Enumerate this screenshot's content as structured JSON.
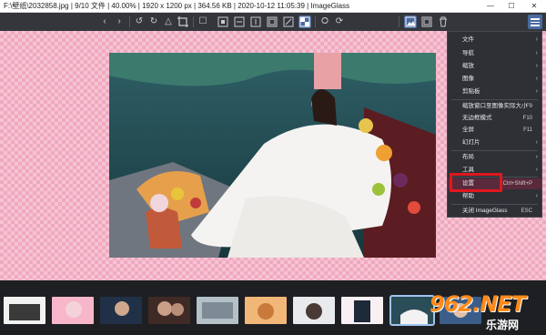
{
  "title_bar": {
    "title": "F:\\壁纸\\2032858.jpg  |  9/10 文件  |  40.00%  |  1920 x 1200 px  |  364.56 KB  |  2020-10-12 11:05:39  |  ImageGlass",
    "minimize_label": "—",
    "maximize_label": "☐",
    "close_label": "✕"
  },
  "toolbar": {
    "icons": [
      "previous-icon",
      "next-icon",
      "rotate-left-icon",
      "rotate-right-icon",
      "flip-icon",
      "crop-icon",
      "zoom-fit-icon",
      "actual-size-icon",
      "fit-width-icon",
      "fit-height-icon",
      "scale-to-fill-icon",
      "lock-zoom-icon",
      "checkerboard-icon",
      "slideshow-icon",
      "thumbnail-icon",
      "fullscreen-icon",
      "delete-icon",
      "menu-icon"
    ]
  },
  "menu": {
    "items": [
      {
        "label": "文件",
        "shortcut": "",
        "submenu": true
      },
      {
        "label": "导航",
        "shortcut": "",
        "submenu": true
      },
      {
        "label": "缩放",
        "shortcut": "",
        "submenu": true
      },
      {
        "label": "图像",
        "shortcut": "",
        "submenu": true
      },
      {
        "label": "剪贴板",
        "shortcut": "",
        "submenu": true
      },
      {
        "label": "缩放窗口至图像实际大小",
        "shortcut": "F9",
        "submenu": false
      },
      {
        "label": "无边框模式",
        "shortcut": "F10",
        "submenu": false
      },
      {
        "label": "全屏",
        "shortcut": "F11",
        "submenu": false
      },
      {
        "label": "幻灯片",
        "shortcut": "",
        "submenu": true
      },
      {
        "label": "布局",
        "shortcut": "",
        "submenu": true
      },
      {
        "label": "工具",
        "shortcut": "",
        "submenu": true
      },
      {
        "label": "设置",
        "shortcut": "Ctrl+Shift+P",
        "submenu": false
      },
      {
        "label": "帮助",
        "shortcut": "",
        "submenu": true
      },
      {
        "label": "关闭 ImageGlass",
        "shortcut": "ESC",
        "submenu": false
      }
    ],
    "highlighted_label": "设置"
  },
  "thumbnails": {
    "count": 10,
    "selected_index": 8
  },
  "watermark": {
    "big": "962.NET",
    "small": "乐游网"
  },
  "colors": {
    "accent": "#4a6aa0",
    "highlight": "#e1171e",
    "menu_bg": "#2e3035"
  }
}
